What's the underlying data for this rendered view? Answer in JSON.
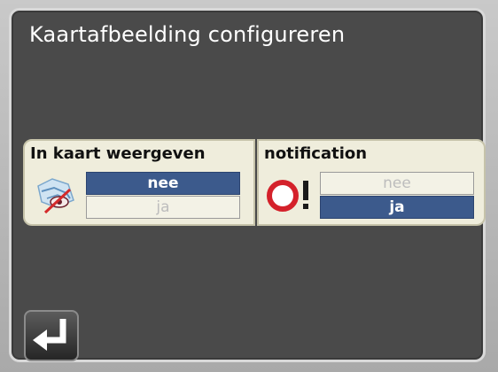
{
  "window": {
    "title": "Kaartafbeelding configureren"
  },
  "settings": [
    {
      "label": "In kaart weergeven",
      "icon": "map-icon",
      "options": [
        "nee",
        "ja"
      ],
      "selected": "nee"
    },
    {
      "label": "notification",
      "icon": "warning-icon",
      "options": [
        "nee",
        "ja"
      ],
      "selected": "ja"
    }
  ],
  "footer": {
    "back_icon": "return-arrow-icon"
  },
  "colors": {
    "background": "#4a4a4a",
    "panel": "#efeddc",
    "selected": "#3c5a8c",
    "warning": "#d4212a"
  }
}
